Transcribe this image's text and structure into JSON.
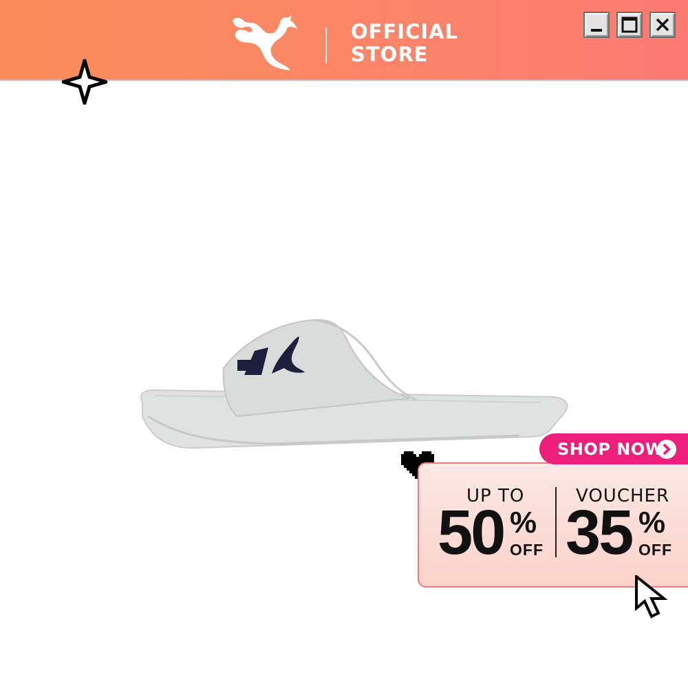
{
  "header": {
    "brand_logo": "puma-cat-logo",
    "store_line1": "OFFICIAL",
    "store_line2": "STORE",
    "window_controls": [
      "minimize-icon",
      "maximize-icon",
      "close-icon"
    ]
  },
  "decorations": [
    "sparkle-icon",
    "heart-icon",
    "cursor-arrow-icon"
  ],
  "product": {
    "image": "grey slide sandal with navy logo"
  },
  "promo": {
    "cta_label": "SHOP NOW",
    "cta_icon": "chevron-right-circle-icon",
    "discount": {
      "prefix": "UP TO",
      "value": "50",
      "percent": "%",
      "suffix": "OFF"
    },
    "voucher": {
      "prefix": "VOUCHER",
      "value": "35",
      "percent": "%",
      "suffix": "OFF"
    }
  },
  "colors": {
    "header_gradient_start": "#fa8d5b",
    "header_gradient_end": "#fb7a73",
    "cta_pink": "#ee1f7c",
    "panel_border": "#f07a7a",
    "panel_bg": "#fbd2c9"
  }
}
